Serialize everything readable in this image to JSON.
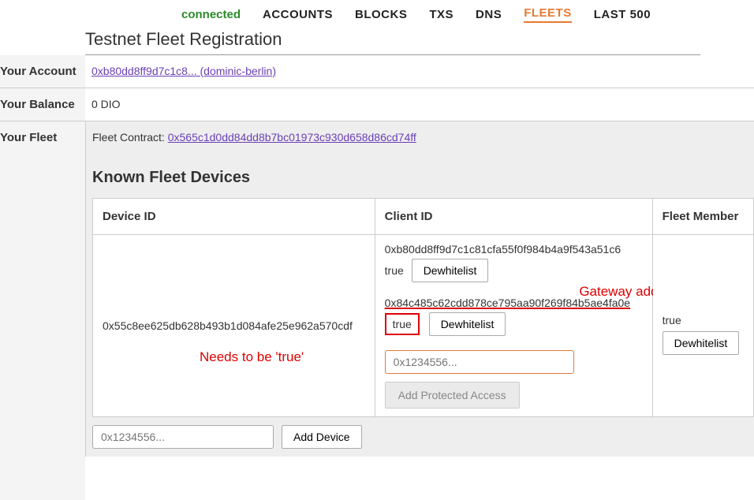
{
  "nav": {
    "status": "connected",
    "items": [
      "ACCOUNTS",
      "BLOCKS",
      "TXS",
      "DNS",
      "FLEETS",
      "LAST 500"
    ],
    "active": "FLEETS"
  },
  "page_title": "Testnet Fleet Registration",
  "account": {
    "label": "Your Account",
    "link_text": "0xb80dd8ff9d7c1c8... (dominic-berlin)"
  },
  "balance": {
    "label": "Your Balance",
    "value": "0 DIO"
  },
  "fleet": {
    "label": "Your Fleet",
    "contract_label": "Fleet Contract:",
    "contract_link": "0x565c1d0dd84dd8b7bc01973c930d658d86cd74ff"
  },
  "devices": {
    "heading": "Known Fleet Devices",
    "cols": {
      "device_id": "Device ID",
      "client_id": "Client ID",
      "fleet_member": "Fleet Member"
    },
    "row": {
      "device_id": "0x55c8ee625db628b493b1d084afe25e962a570cdf",
      "clients": [
        {
          "id": "0xb80dd8ff9d7c1c81cfa55f0f984b4a9f543a51c6",
          "status": "true",
          "dewhitelist": "Dewhitelist"
        },
        {
          "id": "0x84c485c62cdd878ce795aa90f269f84b5ae4fa0e",
          "status": "true",
          "dewhitelist": "Dewhitelist"
        }
      ],
      "member": {
        "status": "true",
        "dewhitelist": "Dewhitelist"
      }
    },
    "client_input_placeholder": "0x1234556...",
    "add_protected_btn": "Add Protected Access",
    "device_input_placeholder": "0x1234556...",
    "add_device_btn": "Add Device"
  },
  "annotations": {
    "needs_true": "Needs to be 'true'",
    "gateway_addr": "Gateway address"
  }
}
